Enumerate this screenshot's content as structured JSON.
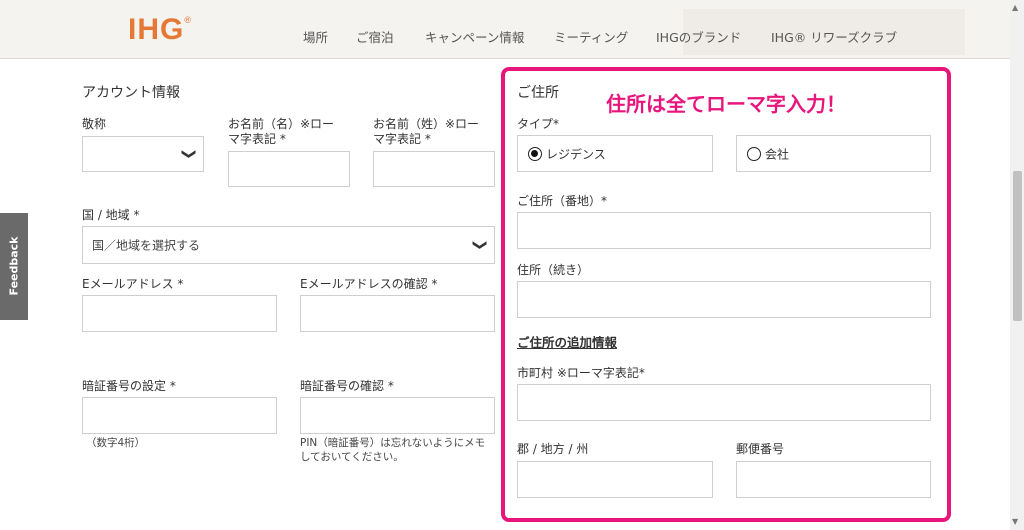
{
  "header": {
    "logo_text": "IHG",
    "logo_mark": "®",
    "nav": [
      "場所",
      "ご宿泊",
      "キャンペーン情報",
      "ミーティング",
      "IHGのブランド",
      "IHG® リワーズクラブ"
    ]
  },
  "feedback_label": "Feedback",
  "account": {
    "section_title": "アカウント情報",
    "title_label": "敬称",
    "first_name_label": "お名前（名）※ロー",
    "first_name_label_2": "マ字表記 *",
    "last_name_label": "お名前（姓）※ロー",
    "last_name_label_2": "マ字表記 *",
    "country_label": "国 / 地域 *",
    "country_placeholder": "国／地域を選択する",
    "email_label": "Eメールアドレス *",
    "email_confirm_label": "Eメールアドレスの確認 *",
    "pin_label": "暗証番号の設定 *",
    "pin_confirm_label": "暗証番号の確認 *",
    "pin_hint": "（数字4桁）",
    "pin_note_1": "PIN（暗証番号）は忘れないようにメモ",
    "pin_note_2": "しておいてください。"
  },
  "address": {
    "section_title": "ご住所",
    "annotation": "住所は全てローマ字入力！",
    "type_label": "タイプ*",
    "type_options": [
      "レジデンス",
      "会社"
    ],
    "type_selected": "レジデンス",
    "street_label": "ご住所（番地）*",
    "street2_label": "住所（続き）",
    "additional_heading": "ご住所の追加情報",
    "city_label": "市町村 ※ローマ字表記*",
    "county_label": "郡 / 地方 / 州",
    "postal_label": "郵便番号"
  },
  "colors": {
    "brand_orange": "#e67835",
    "highlight_pink": "#e8157d"
  }
}
